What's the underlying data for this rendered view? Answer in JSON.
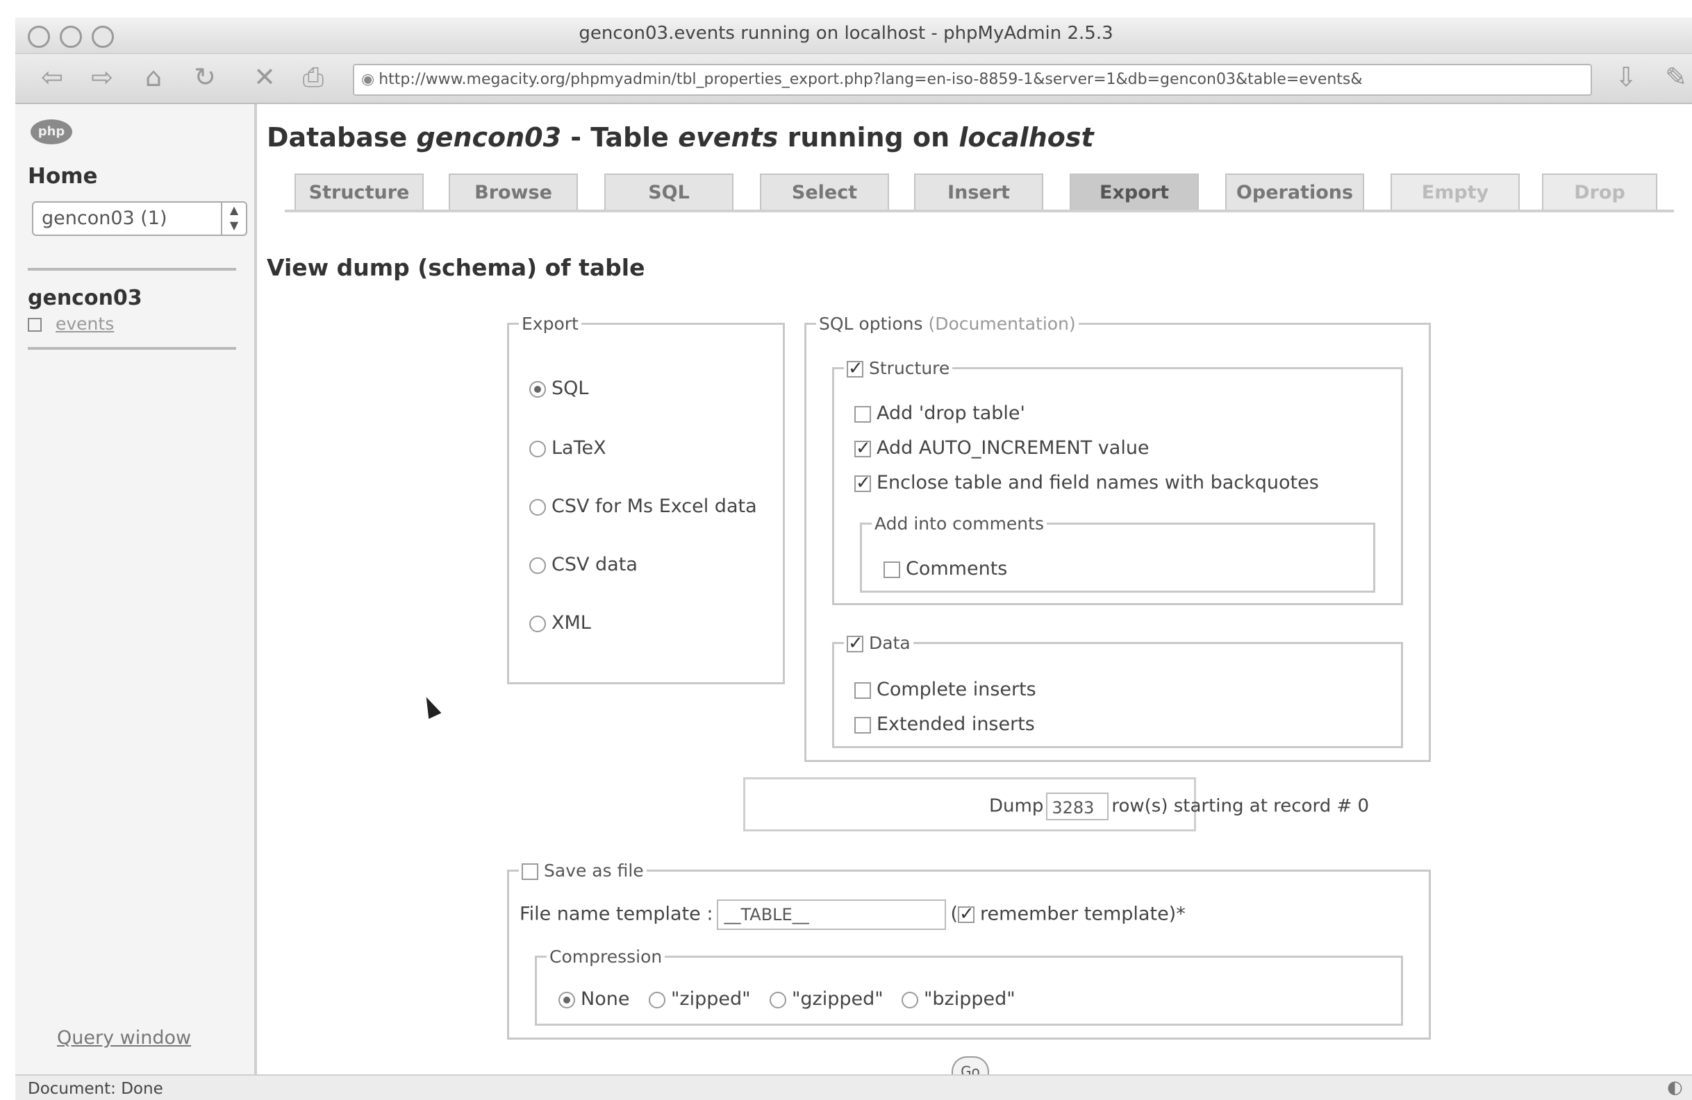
{
  "window": {
    "title": "gencon03.events running on localhost - phpMyAdmin 2.5.3",
    "url": "http://www.megacity.org/phpmyadmin/tbl_properties_export.php?lang=en-iso-8859-1&server=1&db=gencon03&table=events&"
  },
  "left": {
    "home_label": "Home",
    "db_select_value": "gencon03 (1)",
    "db_name": "gencon03",
    "table_name": "events",
    "query_window": "Query window"
  },
  "main": {
    "title_prefix": "Database ",
    "title_db": "gencon03",
    "title_mid": " - Table ",
    "title_table": "events",
    "title_running": " running on ",
    "title_host": "localhost",
    "tabs": [
      "Structure",
      "Browse",
      "SQL",
      "Select",
      "Insert",
      "Export",
      "Operations",
      "Empty",
      "Drop"
    ],
    "active_tab": "Export",
    "section_heading": "View dump (schema) of table"
  },
  "export": {
    "legend": "Export",
    "formats": [
      "SQL",
      "LaTeX",
      "CSV for Ms Excel data",
      "CSV data",
      "XML"
    ],
    "selected": "SQL"
  },
  "sql_options": {
    "legend": "SQL options",
    "doc_link": "(Documentation)",
    "structure_label": "Structure",
    "add_drop_table": "Add 'drop table'",
    "add_auto_increment": "Add AUTO_INCREMENT value",
    "enclose_backquotes": "Enclose table and field names with backquotes",
    "add_into_comments": "Add into comments",
    "comments": "Comments",
    "data_label": "Data",
    "complete_inserts": "Complete inserts",
    "extended_inserts": "Extended inserts"
  },
  "dump": {
    "prefix": "Dump",
    "rows_value": "3283",
    "suffix": "row(s) starting at record # 0"
  },
  "save_file": {
    "legend": "Save as file",
    "template_label": "File name template :",
    "template_value": "__TABLE__",
    "paren_open": "(",
    "remember": "remember template)*",
    "compression_legend": "Compression",
    "compression_options": [
      "None",
      "\"zipped\"",
      "\"gzipped\"",
      "\"bzipped\""
    ],
    "compression_selected": "None"
  },
  "go_label": "Go",
  "status": "Document: Done"
}
